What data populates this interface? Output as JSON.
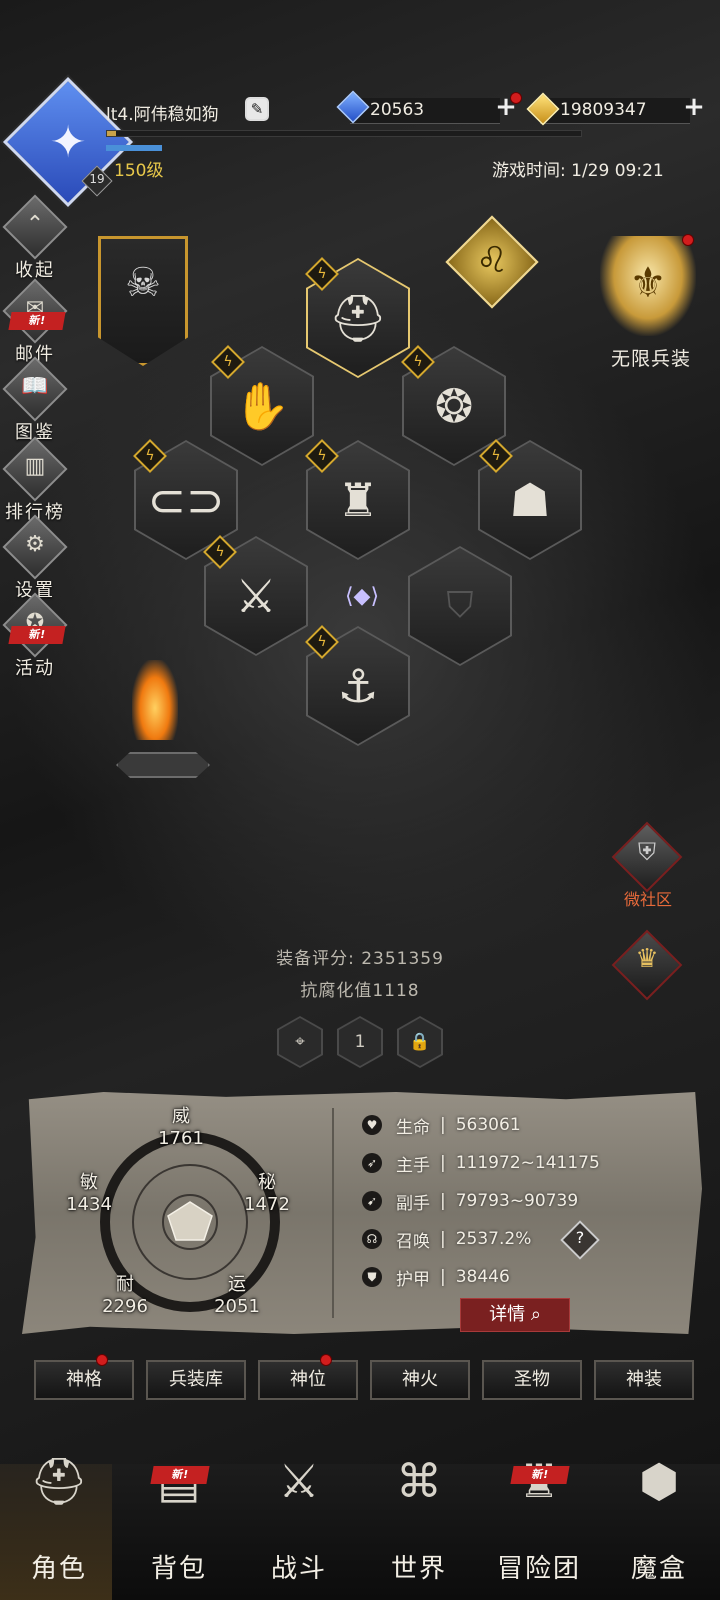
{
  "player": {
    "name": "lt4.阿伟稳如狗",
    "level_badge": "19",
    "level": "150级",
    "xp_progress": 0.02,
    "game_time": "游戏时间: 1/29 09:21"
  },
  "currency": {
    "diamonds": "20563",
    "gold": "19809347"
  },
  "side_menu": [
    {
      "label": "收起",
      "icon": "collapse-icon",
      "new": false
    },
    {
      "label": "邮件",
      "icon": "mail-icon",
      "new": true
    },
    {
      "label": "图鉴",
      "icon": "book-icon",
      "new": false
    },
    {
      "label": "排行榜",
      "icon": "ranking-icon",
      "new": false
    },
    {
      "label": "设置",
      "icon": "gear-icon",
      "new": false
    },
    {
      "label": "活动",
      "icon": "event-icon",
      "new": true
    }
  ],
  "new_tag": "新!",
  "infinite_gear": {
    "label": "无限兵装"
  },
  "community": {
    "label": "微社区"
  },
  "score": {
    "equip_score": "装备评分: 2351359",
    "corruption": "抗腐化值1118"
  },
  "page_indicator": "1",
  "attributes": [
    {
      "name": "威",
      "value": "1761"
    },
    {
      "name": "秘",
      "value": "1472"
    },
    {
      "name": "运",
      "value": "2051"
    },
    {
      "name": "耐",
      "value": "2296"
    },
    {
      "name": "敏",
      "value": "1434"
    }
  ],
  "stats": [
    {
      "label": "生命",
      "value": "563061",
      "icon": "heart-icon"
    },
    {
      "label": "主手",
      "value": "111972~141175",
      "icon": "sword-icon"
    },
    {
      "label": "副手",
      "value": "79793~90739",
      "icon": "dagger-icon"
    },
    {
      "label": "召唤",
      "value": "2537.2%",
      "icon": "summon-icon"
    },
    {
      "label": "护甲",
      "value": "38446",
      "icon": "armor-icon"
    }
  ],
  "stat_sep": "|",
  "detail_button": "详情",
  "tabs": [
    "神格",
    "兵装库",
    "神位",
    "神火",
    "圣物",
    "神装"
  ],
  "nav": [
    {
      "label": "角色",
      "icon": "helmet-icon",
      "new": false
    },
    {
      "label": "背包",
      "icon": "backpack-icon",
      "new": true
    },
    {
      "label": "战斗",
      "icon": "shield-sword-icon",
      "new": false
    },
    {
      "label": "世界",
      "icon": "map-icon",
      "new": false
    },
    {
      "label": "冒险团",
      "icon": "castle-icon",
      "new": true
    },
    {
      "label": "魔盒",
      "icon": "cube-icon",
      "new": false
    }
  ],
  "colors": {
    "gold_accent": "#c8962e",
    "level_yellow": "#e8c84a",
    "alert_red": "#d21d1d",
    "detail_red": "#7a2020"
  }
}
